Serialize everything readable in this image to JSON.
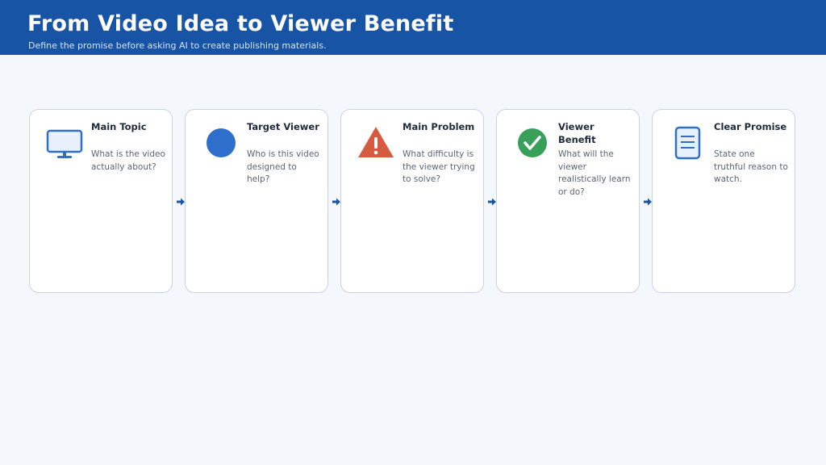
{
  "header": {
    "title": "From Video Idea to Viewer Benefit",
    "subtitle": "Define the promise before asking AI to create publishing materials."
  },
  "colors": {
    "header_bg": "#1854a6",
    "accent_blue": "#2d6fcb",
    "warning_red": "#d65a3f",
    "success_green": "#38a05a",
    "arrow": "#1854a6"
  },
  "steps": [
    {
      "title": "Main Topic",
      "description": "What is the video actually about?",
      "icon": "monitor-icon"
    },
    {
      "title": "Target Viewer",
      "description": "Who is this video designed to help?",
      "icon": "circle-icon"
    },
    {
      "title": "Main Problem",
      "description": "What difficulty is the viewer trying to solve?",
      "icon": "warning-icon"
    },
    {
      "title": "Viewer Benefit",
      "description": "What will the viewer realistically learn or do?",
      "icon": "checkmark-icon"
    },
    {
      "title": "Clear Promise",
      "description": "State one truthful reason to watch.",
      "icon": "document-icon"
    }
  ]
}
